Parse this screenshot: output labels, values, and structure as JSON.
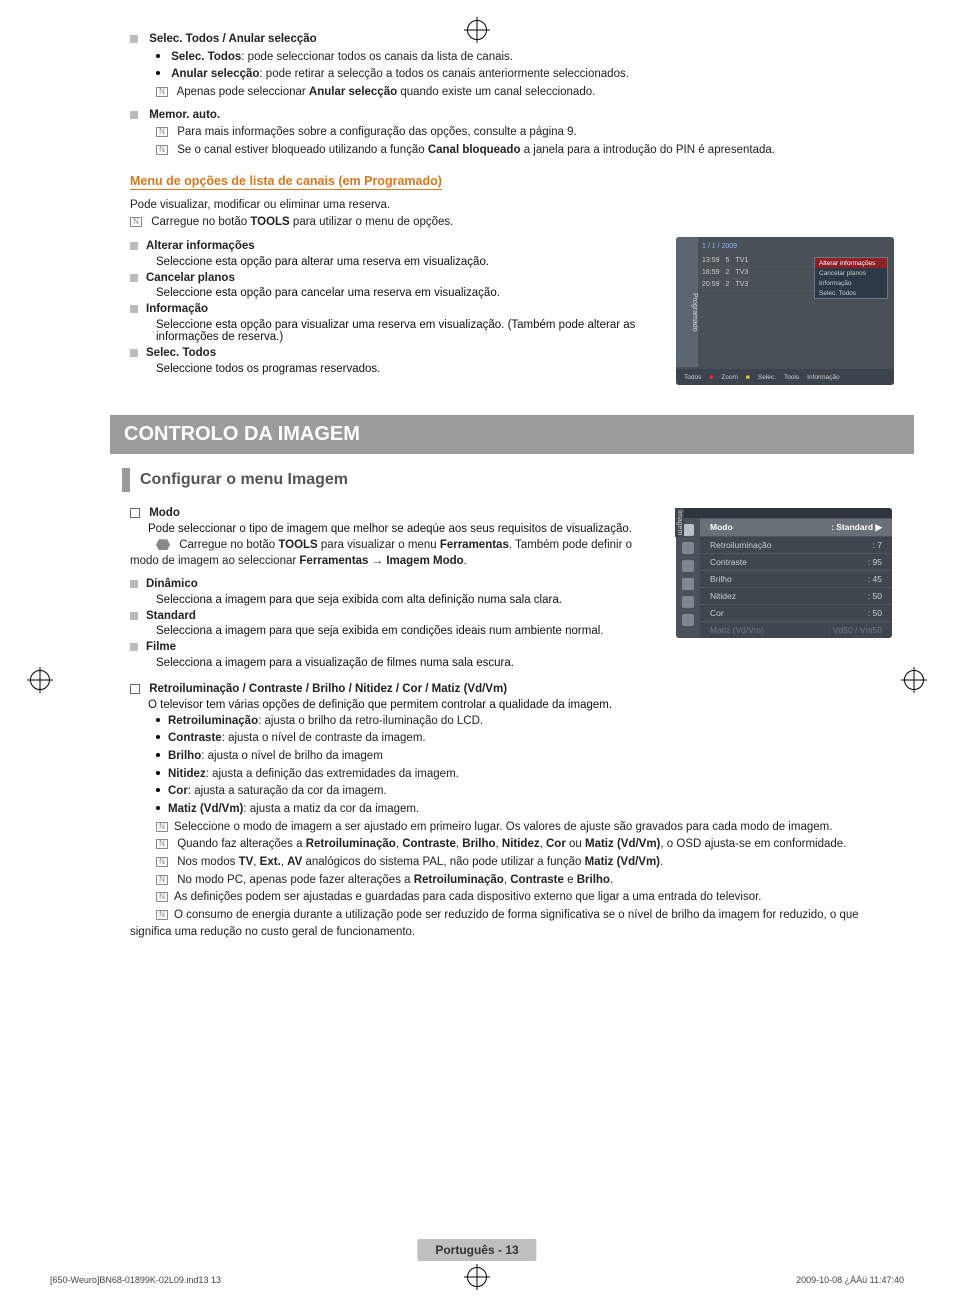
{
  "sec_select": {
    "heading": "Selec. Todos / Anular selecção",
    "b1_bold": "Selec. Todos",
    "b1_rest": ": pode seleccionar todos os canais da lista de canais.",
    "b2_bold": "Anular selecção",
    "b2_rest": ": pode retirar a selecção a todos os canais anteriormente seleccionados.",
    "n1_a": "Apenas pode seleccionar ",
    "n1_bold": "Anular selecção",
    "n1_b": " quando existe um canal seleccionado."
  },
  "sec_memor": {
    "heading": "Memor. auto.",
    "n1": "Para mais informações sobre a configuração das opções, consulte a página 9.",
    "n2_a": "Se o canal estiver bloqueado utilizando a função ",
    "n2_bold": "Canal bloqueado",
    "n2_b": " a janela para a introdução do PIN é apresentada."
  },
  "menu_opcoes": {
    "title": "Menu de opções de lista de canais (em Programado)",
    "intro": "Pode visualizar, modificar ou eliminar uma reserva.",
    "note_a": "Carregue no botão ",
    "note_bold": "TOOLS",
    "note_b": " para utilizar o menu de opções.",
    "items": [
      {
        "h": "Alterar informações",
        "d": "Seleccione esta opção para alterar uma reserva em visualização."
      },
      {
        "h": "Cancelar planos",
        "d": "Seleccione esta opção para cancelar uma reserva em visualização."
      },
      {
        "h": "Informação",
        "d": "Seleccione esta opção para visualizar uma reserva em visualização. (Também pode alterar as informações de reserva.)"
      },
      {
        "h": "Selec. Todos",
        "d": "Seleccione todos os programas reservados."
      }
    ]
  },
  "osd1": {
    "side": "Programado",
    "date": "1 / 1 / 2009",
    "rows": [
      [
        "13:59",
        "5",
        "TV1"
      ],
      [
        "18:59",
        "2",
        "TV3"
      ],
      [
        "20:59",
        "2",
        "TV3"
      ]
    ],
    "menu": [
      "Alterar informações",
      "Cancelar planos",
      "Informação",
      "Selec. Todos"
    ],
    "foot": [
      "Todos",
      "Zoom",
      "Selec.",
      "Tools",
      "Informação"
    ]
  },
  "band": "CONTROLO DA IMAGEM",
  "section2": "Configurar o menu Imagem",
  "modo": {
    "heading": "Modo",
    "intro": "Pode seleccionar o tipo de imagem que melhor se adeqúe aos seus requisitos de visualização.",
    "t_a": "Carregue no botão ",
    "t_b1": "TOOLS",
    "t_c": " para visualizar o menu ",
    "t_b2": "Ferramentas",
    "t_d": ". Também pode definir o modo de imagem ao seleccionar ",
    "t_b3": "Ferramentas → Imagem Modo",
    "t_e": ".",
    "items": [
      {
        "h": "Dinâmico",
        "d": "Selecciona a imagem para que seja exibida com alta definição numa sala clara."
      },
      {
        "h": "Standard",
        "d": "Selecciona a imagem para que seja exibida em condições ideais num ambiente normal."
      },
      {
        "h": "Filme",
        "d": "Selecciona a imagem para a visualização de filmes numa sala escura."
      }
    ]
  },
  "osd2": {
    "side": "Imagem",
    "rows": [
      {
        "k": "Modo",
        "v": ": Standard  ▶",
        "sel": true
      },
      {
        "k": "Retroiluminação",
        "v": ": 7"
      },
      {
        "k": "Contraste",
        "v": ": 95"
      },
      {
        "k": "Brilho",
        "v": ": 45"
      },
      {
        "k": "Nitidez",
        "v": ": 50"
      },
      {
        "k": "Cor",
        "v": ": 50"
      },
      {
        "k": "Matiz (Vd/Vm)",
        "v": ": Vd50 / Vm50",
        "dim": true
      }
    ]
  },
  "retro": {
    "heading": "Retroiluminação / Contraste / Brilho / Nitidez / Cor / Matiz (Vd/Vm)",
    "intro": "O televisor tem várias opções de definição que permitem controlar a qualidade da imagem.",
    "bullets": [
      {
        "b": "Retroiluminação",
        "r": ": ajusta o brilho da retro-iluminação do LCD."
      },
      {
        "b": "Contraste",
        "r": ": ajusta o nível de contraste da imagem."
      },
      {
        "b": "Brilho",
        "r": ": ajusta o nível de brilho da imagem"
      },
      {
        "b": "Nitidez",
        "r": ": ajusta a definição das extremidades da imagem."
      },
      {
        "b": "Cor",
        "r": ": ajusta a saturação da cor da imagem."
      },
      {
        "b": "Matiz (Vd/Vm)",
        "r": ": ajusta a matiz da cor da imagem."
      }
    ],
    "notes": {
      "n1": "Seleccione o modo de imagem a ser ajustado em primeiro lugar. Os valores de ajuste são gravados para cada modo de imagem.",
      "n2": {
        "a": "Quando faz alterações a ",
        "b": "Retroiluminação",
        "c": ", ",
        "d": "Contraste",
        "e": ", ",
        "f": "Brilho",
        "g": ", ",
        "h": "Nitidez",
        "i": ", ",
        "j": "Cor",
        "k": " ou ",
        "l": "Matiz (Vd/Vm)",
        "m": ", o OSD ajusta-se em conformidade."
      },
      "n3": {
        "a": "Nos modos ",
        "b": "TV",
        "c": ", ",
        "d": "Ext.",
        "e": ", ",
        "f": "AV",
        "g": " analógicos do sistema PAL, não pode utilizar a função ",
        "h": "Matiz (Vd/Vm)",
        "i": "."
      },
      "n4": {
        "a": "No modo PC, apenas pode fazer alterações a ",
        "b": "Retroiluminação",
        "c": ", ",
        "d": "Contraste",
        "e": " e ",
        "f": "Brilho",
        "g": "."
      },
      "n5": "As definições podem ser ajustadas e guardadas para cada dispositivo externo que ligar a uma entrada do televisor.",
      "n6": "O consumo de energia durante a utilização pode ser reduzido de forma significativa se o nível de brilho da imagem for reduzido, o que significa uma redução no custo geral de funcionamento."
    }
  },
  "footer": {
    "lang": "Português - 13",
    "left": "[650-Weuro]BN68-01899K-02L09.ind13   13",
    "right": "2009-10-08   ¿ÀÀü 11:47:40"
  }
}
